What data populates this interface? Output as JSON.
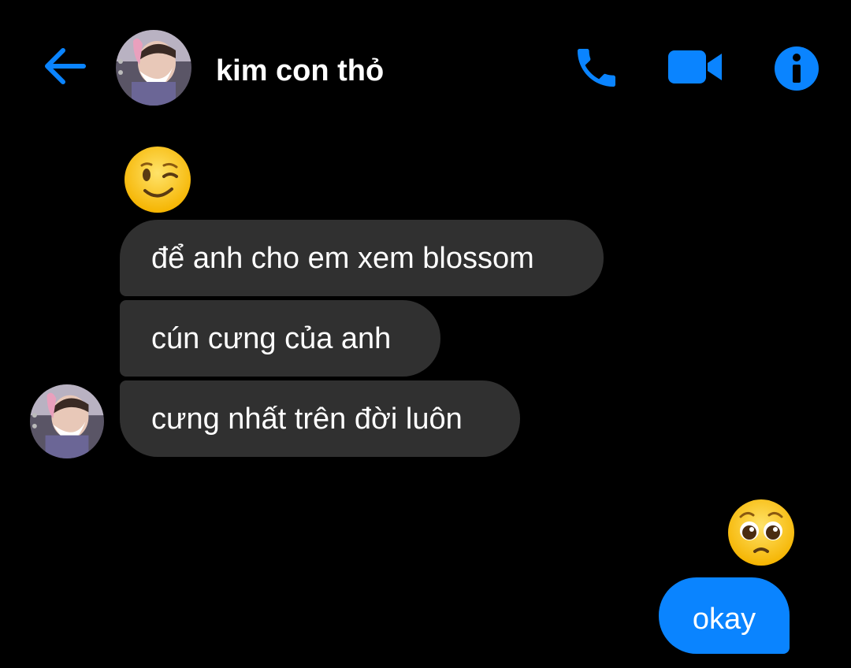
{
  "header": {
    "contact_name": "kim con thỏ",
    "back_icon": "back-arrow-icon",
    "call_icon": "phone-icon",
    "video_icon": "video-camera-icon",
    "info_icon": "info-icon"
  },
  "messages": {
    "incoming_emoji": "winking-face-emoji",
    "incoming": [
      "để anh cho em xem blossom",
      "cún cưng của anh",
      "cưng nhất trên đời luôn"
    ],
    "outgoing_emoji": "pleading-face-emoji",
    "outgoing": [
      "okay"
    ]
  },
  "colors": {
    "accent": "#0a84ff",
    "background": "#000000",
    "incoming_bubble": "#303030",
    "text": "#ffffff"
  }
}
